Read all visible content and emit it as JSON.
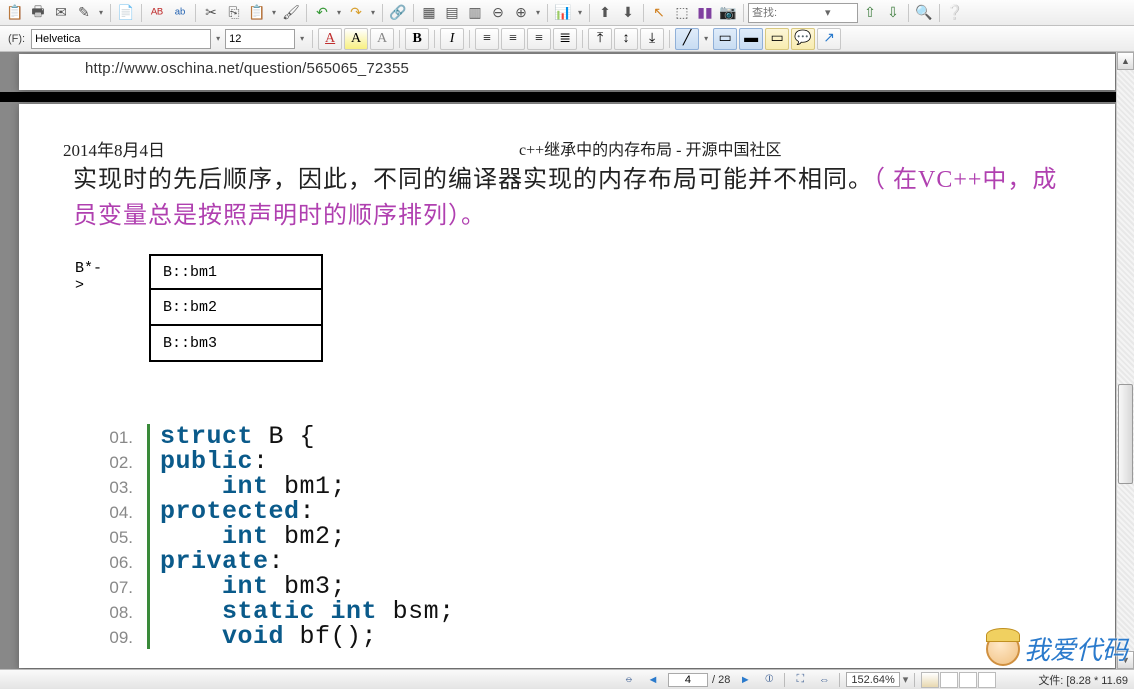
{
  "toolbar1": {
    "search_placeholder": "查找:"
  },
  "toolbar2": {
    "label_f": "(F):",
    "font": "Helvetica",
    "size": "12"
  },
  "document": {
    "url_text": "http://www.oschina.net/question/565065_72355",
    "date": "2014年8月4日",
    "title": "c++继承中的内存布局 - 开源中国社区",
    "para_black": "实现时的先后顺序，因此，不同的编译器实现的内存布局可能并不相同。",
    "para_purple": "（  在VC++中，成员变量总是按照声明时的顺序排列）。",
    "mem_pointer": "B*->",
    "mem_rows": [
      "B::bm1",
      "B::bm2",
      "B::bm3"
    ],
    "code": [
      {
        "n": "01.",
        "t": "struct B {",
        "kw": [
          "struct"
        ]
      },
      {
        "n": "02.",
        "t": "public:",
        "kw": [
          "public"
        ]
      },
      {
        "n": "03.",
        "t": "    int bm1;",
        "kw": [
          "int"
        ]
      },
      {
        "n": "04.",
        "t": "protected:",
        "kw": [
          "protected"
        ]
      },
      {
        "n": "05.",
        "t": "    int bm2;",
        "kw": [
          "int"
        ]
      },
      {
        "n": "06.",
        "t": "private:",
        "kw": [
          "private"
        ]
      },
      {
        "n": "07.",
        "t": "    int bm3;",
        "kw": [
          "int"
        ]
      },
      {
        "n": "08.",
        "t": "    static int bsm;",
        "kw": [
          "static",
          "int"
        ]
      },
      {
        "n": "09.",
        "t": "    void bf();",
        "kw": [
          "void"
        ]
      }
    ]
  },
  "statusbar": {
    "page_current": "4",
    "page_total": "/ 28",
    "zoom": "152.64%",
    "file_info": "文件: [8.28 * 11.69"
  },
  "watermark": "我爱代码"
}
